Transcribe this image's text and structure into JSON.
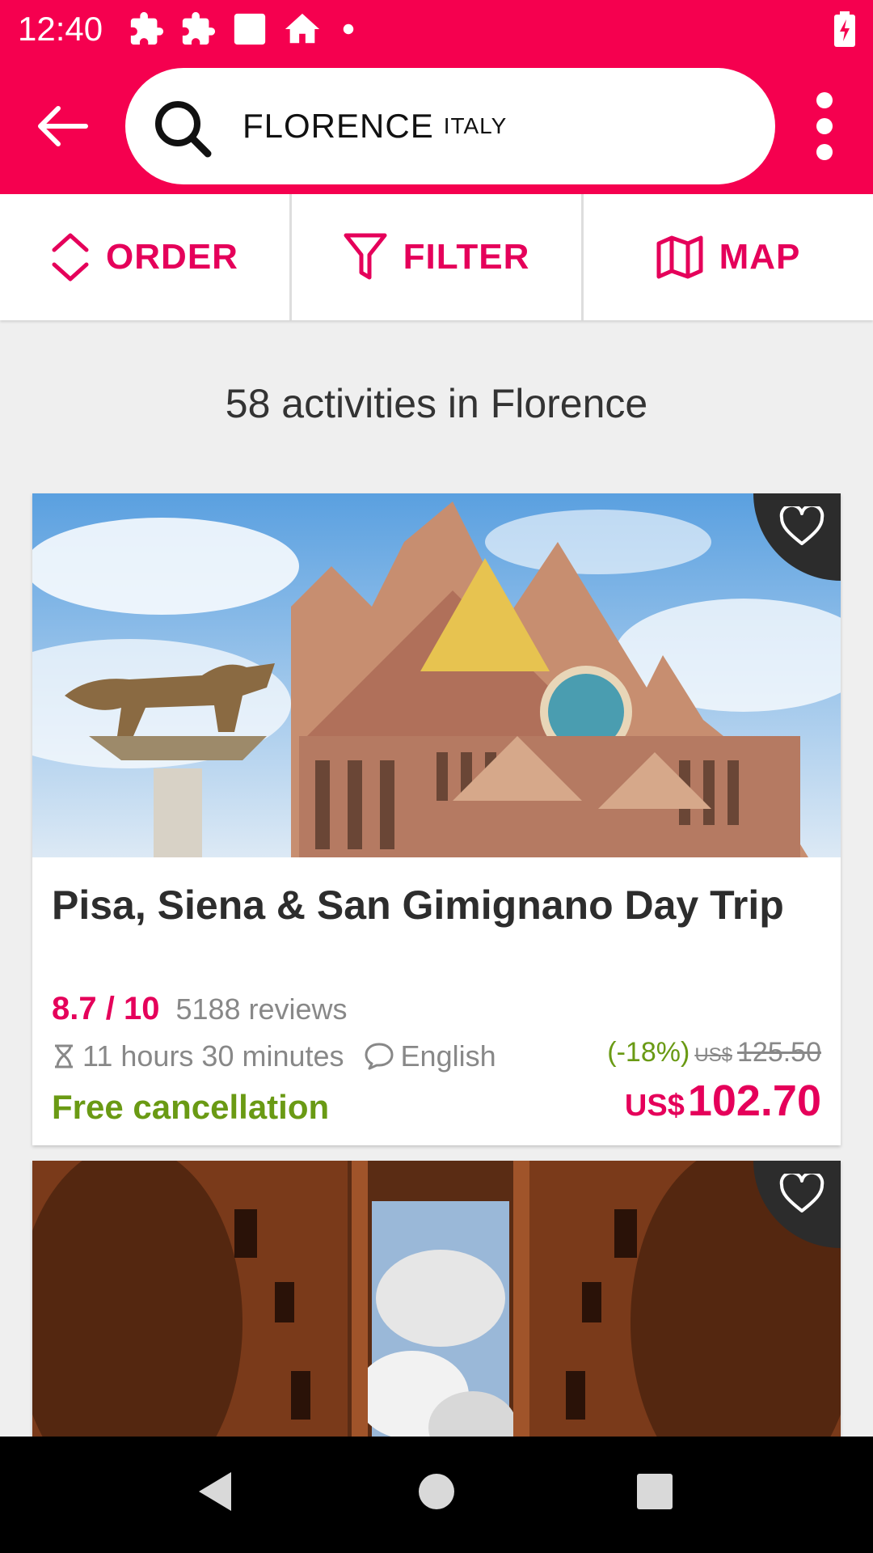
{
  "status_bar": {
    "time": "12:40"
  },
  "search": {
    "city": "FLORENCE",
    "country": "ITALY"
  },
  "toolbar": {
    "order": "ORDER",
    "filter": "FILTER",
    "map": "MAP"
  },
  "result_count": "58 activities in Florence",
  "cards": [
    {
      "title": "Pisa, Siena & San Gimignano Day Trip",
      "rating": "8.7 / 10",
      "reviews": "5188 reviews",
      "duration": "11 hours 30 minutes",
      "language": "English",
      "discount": "(-18%)",
      "old_currency": "US$",
      "old_price": "125.50",
      "free_cancellation": "Free cancellation",
      "new_currency": "US$",
      "new_price": "102.70"
    }
  ],
  "colors": {
    "brand": "#f5004f",
    "accent": "#e5005a",
    "green": "#6a9a14"
  }
}
